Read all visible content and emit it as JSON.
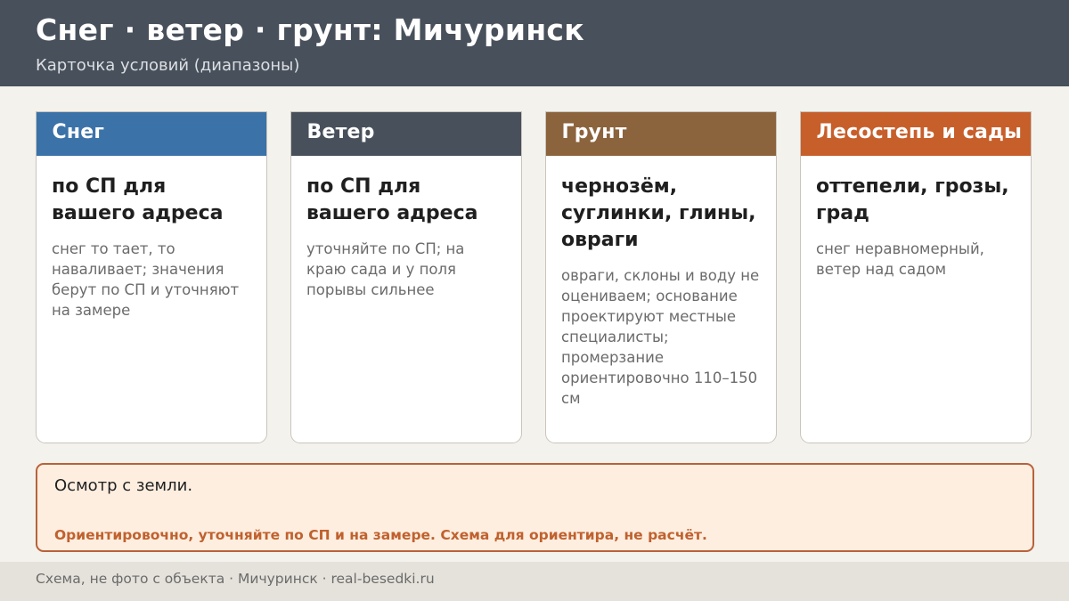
{
  "header": {
    "title": "Снег · ветер · грунт: Мичуринск",
    "subtitle": "Карточка условий (диапазоны)"
  },
  "cards": [
    {
      "label": "Снег",
      "color": "#3b72a8",
      "main": "по СП для вашего адреса",
      "note": "снег то тает, то наваливает; значения берут по СП и уточняют на замере"
    },
    {
      "label": "Ветер",
      "color": "#48505b",
      "main": "по СП для вашего адреса",
      "note": "уточняйте по СП; на краю сада и у поля порывы сильнее"
    },
    {
      "label": "Грунт",
      "color": "#8b633d",
      "main": "чернозём, суглинки, глины, овраги",
      "note": "овраги, склоны и воду не оцениваем; основание проектируют местные специалисты; промерзание ориентировочно 110–150 см"
    },
    {
      "label": "Лесостепь и сады",
      "color": "#c75f2b",
      "main": "оттепели, грозы, град",
      "note": "снег неравномерный, ветер над садом"
    }
  ],
  "notice": {
    "text": "Осмотр с земли.",
    "warning": "Ориентировочно, уточняйте по СП и на замере. Схема для ориентира, не расчёт.",
    "border_color": "#b8623a",
    "background_color": "#fdeee0"
  },
  "footer": {
    "text": "Схема, не фото с объекта  ·  Мичуринск  ·  real-besedki.ru"
  }
}
